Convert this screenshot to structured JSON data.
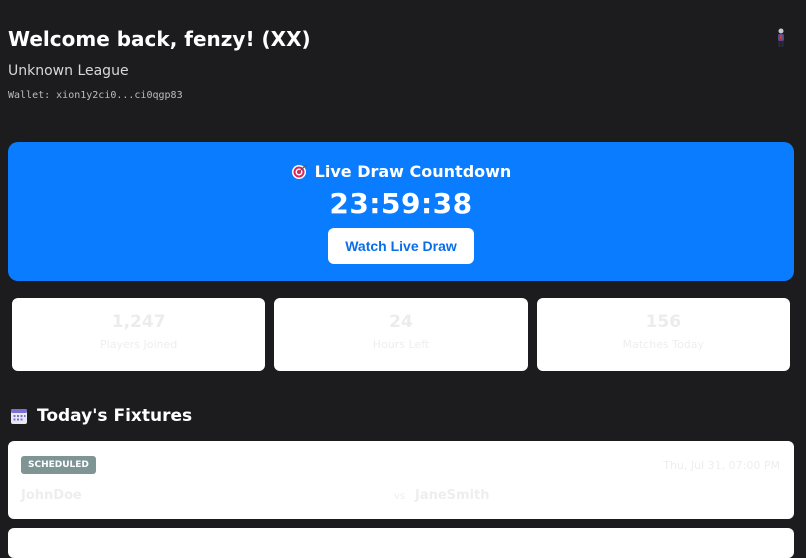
{
  "header": {
    "welcome": "Welcome back, fenzy! (XX)",
    "league": "Unknown League",
    "wallet": "Wallet: xion1y2ci0...ci0qgp83",
    "top_icon": "figure-icon"
  },
  "countdown": {
    "icon": "target-icon",
    "title": "Live Draw Countdown",
    "time": "23:59:38",
    "button_label": "Watch Live Draw"
  },
  "stats": [
    {
      "value": "1,247",
      "label": "Players Joined"
    },
    {
      "value": "24",
      "label": "Hours Left"
    },
    {
      "value": "156",
      "label": "Matches Today"
    }
  ],
  "fixtures": {
    "icon": "calendar-icon",
    "title": "Today's Fixtures",
    "items": [
      {
        "status": "SCHEDULED",
        "time": "Thu, Jul 31, 07:00 PM",
        "team_a": "JohnDoe",
        "vs": "vs",
        "team_b": "JaneSmith"
      }
    ]
  },
  "colors": {
    "background": "#1c1c1e",
    "accent": "#0a7cff",
    "badge": "#7f9595"
  }
}
